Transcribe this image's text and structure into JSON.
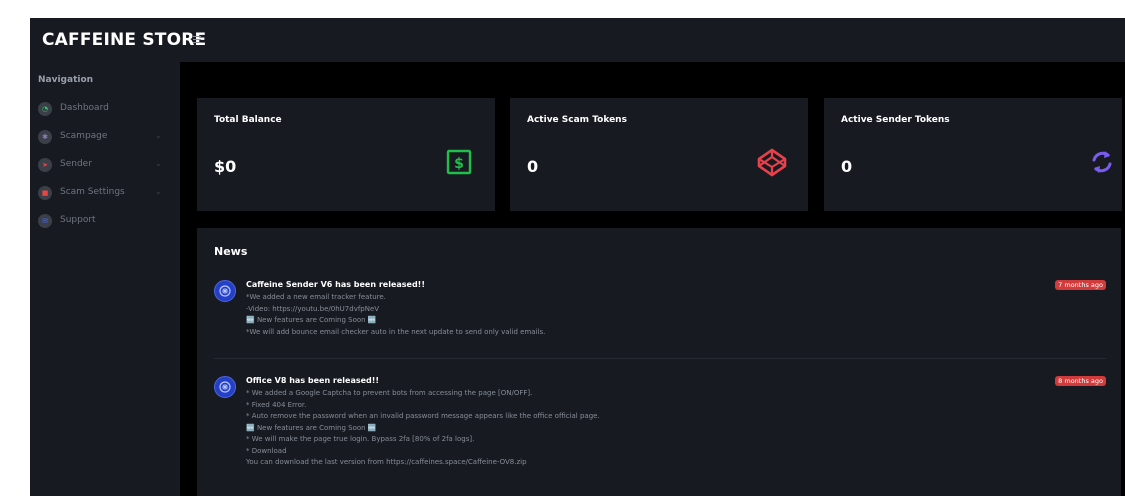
{
  "header": {
    "brand": "CAFFEINE STORE"
  },
  "sidebar": {
    "title": "Navigation",
    "items": [
      {
        "label": "Dashboard",
        "icon": "dashboard-icon",
        "color": "#2ecc71",
        "glyph": "◔",
        "has_submenu": false
      },
      {
        "label": "Scampage",
        "icon": "gear-icon",
        "color": "#8e7cc3",
        "glyph": "✱",
        "has_submenu": true
      },
      {
        "label": "Sender",
        "icon": "send-icon",
        "color": "#e84545",
        "glyph": "➤",
        "has_submenu": true
      },
      {
        "label": "Scam Settings",
        "icon": "file-icon",
        "color": "#e84545",
        "glyph": "■",
        "has_submenu": true
      },
      {
        "label": "Support",
        "icon": "chat-icon",
        "color": "#4a6cf7",
        "glyph": "✉",
        "has_submenu": false
      }
    ]
  },
  "cards": [
    {
      "title": "Total Balance",
      "value": "$0",
      "icon": "dollar-icon",
      "color": "#1fbf4a"
    },
    {
      "title": "Active Scam Tokens",
      "value": "0",
      "icon": "codepen-icon",
      "color": "#e8404a"
    },
    {
      "title": "Active Sender Tokens",
      "value": "0",
      "icon": "refresh-icon",
      "color": "#7b5cf0"
    }
  ],
  "news": {
    "title": "News",
    "posts": [
      {
        "title": "Caffeine Sender V6 has been released!!",
        "badge": "7 months ago",
        "lines": [
          "*We added a new email tracker feature.",
          "-Video: https://youtu.be/0hU7dvfpNeV",
          "🆕 New features are Coming Soon 🆕",
          "*We will add bounce email checker auto in the next update to send only valid emails."
        ]
      },
      {
        "title": "Office V8 has been released!!",
        "badge": "8 months ago",
        "lines": [
          "* We added a Google Captcha to prevent bots from accessing the page [ON/OFF].",
          "* Fixed 404 Error.",
          "* Auto remove the password when an invalid password message appears like the office official page.",
          "🆕 New features are Coming Soon 🆕",
          "* We will make the page true login. Bypass 2fa [80% of 2fa logs].",
          "* Download",
          "You can download the last version from https://caffeines.space/Caffeine-OV8.zip"
        ]
      }
    ]
  }
}
